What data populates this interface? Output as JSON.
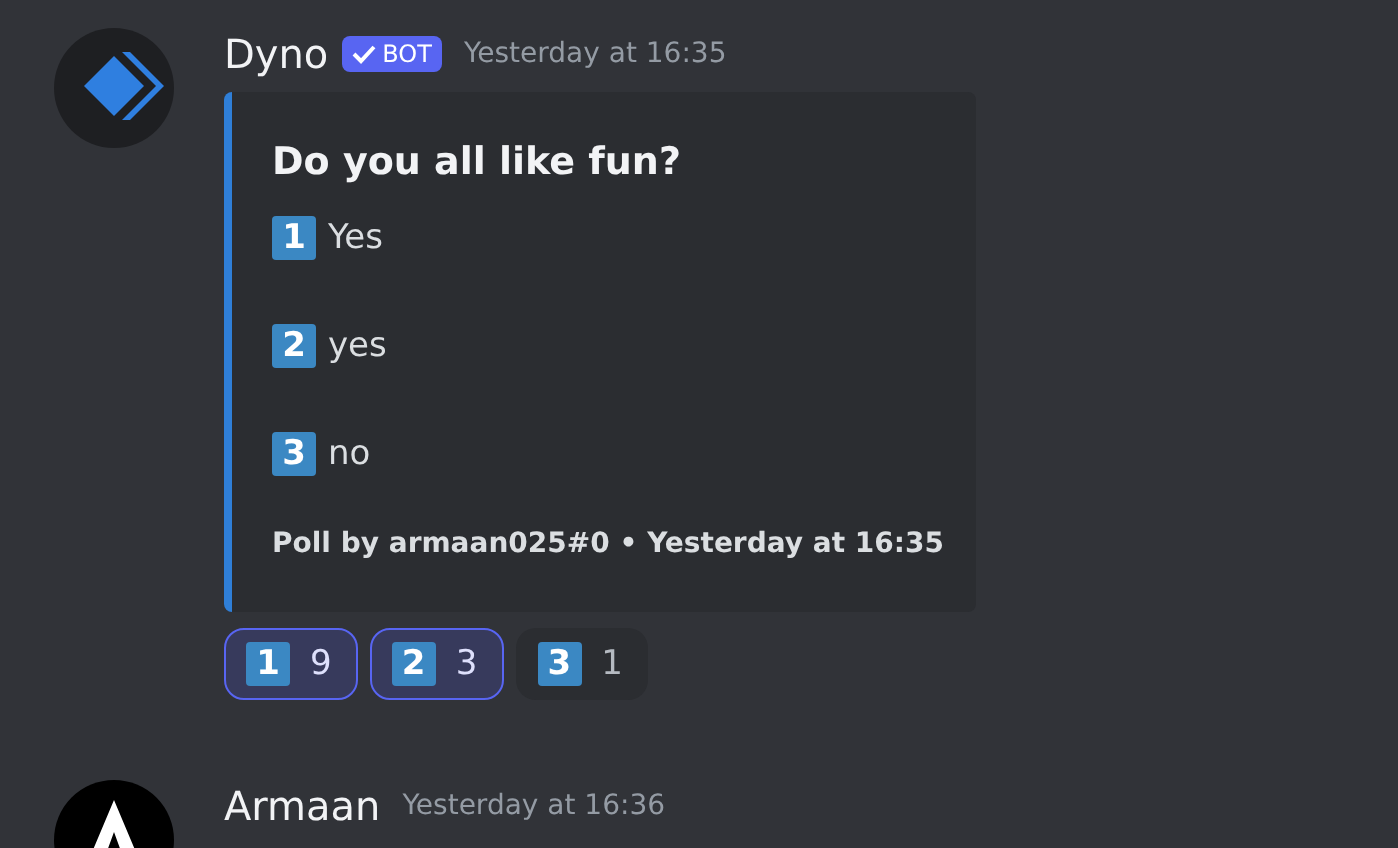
{
  "messages": [
    {
      "author": "Dyno",
      "kind": "bot",
      "bot_tag": {
        "label": "BOT",
        "verified": true
      },
      "timestamp": "Yesterday at 16:35",
      "embed": {
        "title": "Do you all like fun?",
        "options": [
          {
            "key": "1",
            "label": "Yes"
          },
          {
            "key": "2",
            "label": "yes"
          },
          {
            "key": "3",
            "label": "no"
          }
        ],
        "footer": "Poll by armaan025#0 • Yesterday at 16:35"
      },
      "reactions": [
        {
          "key": "1",
          "count": "9",
          "selected": true
        },
        {
          "key": "2",
          "count": "3",
          "selected": true
        },
        {
          "key": "3",
          "count": "1",
          "selected": false
        }
      ]
    },
    {
      "author": "Armaan",
      "kind": "user",
      "timestamp": "Yesterday at 16:36"
    }
  ]
}
